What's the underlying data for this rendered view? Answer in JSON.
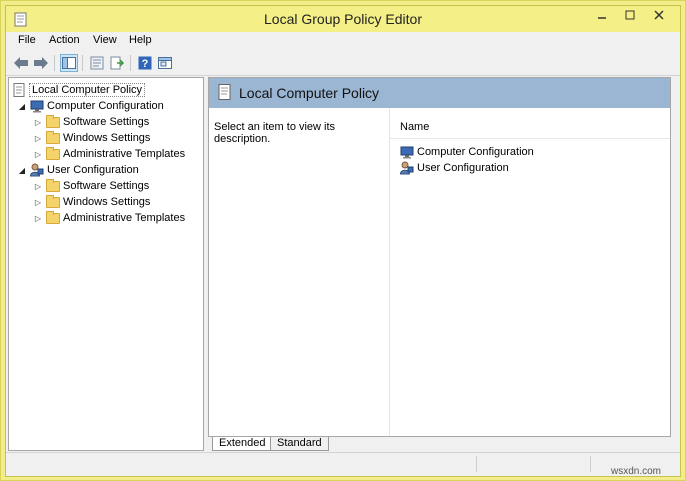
{
  "window": {
    "title": "Local Group Policy Editor"
  },
  "menu": [
    "File",
    "Action",
    "View",
    "Help"
  ],
  "toolbar": {
    "icons": [
      "back-arrow-icon",
      "forward-arrow-icon",
      "show-hide-tree-icon",
      "properties-icon",
      "export-list-icon",
      "help-icon",
      "console-tree-icon"
    ]
  },
  "tree": {
    "root": "Local Computer Policy",
    "computer": {
      "label": "Computer Configuration",
      "children": [
        "Software Settings",
        "Windows Settings",
        "Administrative Templates"
      ]
    },
    "user": {
      "label": "User Configuration",
      "children": [
        "Software Settings",
        "Windows Settings",
        "Administrative Templates"
      ]
    }
  },
  "right": {
    "title": "Local Computer Policy",
    "description": "Select an item to view its description.",
    "column_name": "Name",
    "items": [
      "Computer Configuration",
      "User Configuration"
    ]
  },
  "tabs": [
    "Extended",
    "Standard"
  ],
  "watermark": "wsxdn.com",
  "colors": {
    "titlebar": "#f4ef87",
    "header_band": "#9bb6d3"
  }
}
